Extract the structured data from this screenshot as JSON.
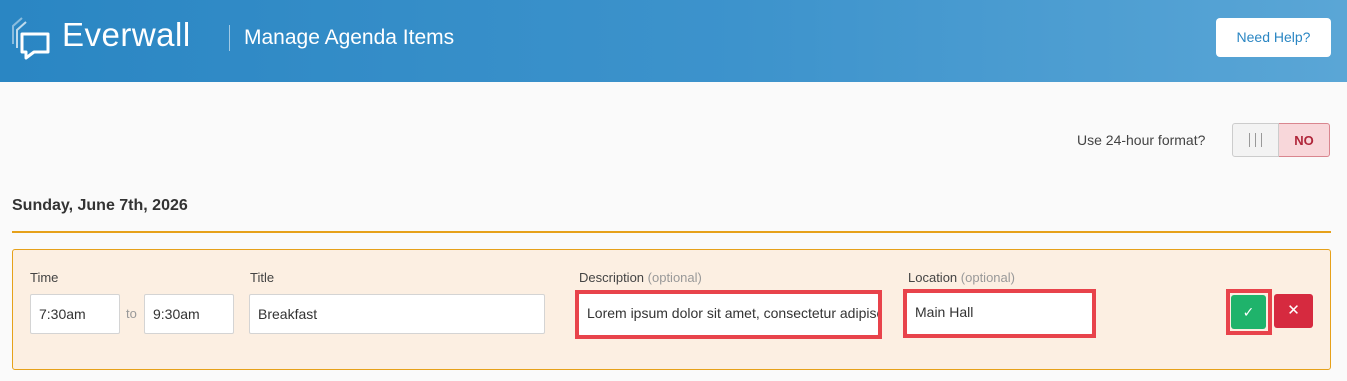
{
  "header": {
    "brand": "Everwall",
    "page_title": "Manage Agenda Items",
    "help_label": "Need Help?"
  },
  "time_format": {
    "label": "Use 24-hour format?",
    "state": "NO"
  },
  "day": {
    "heading": "Sunday, June 7th, 2026"
  },
  "agenda_item": {
    "time_label": "Time",
    "start_time": "7:30am",
    "to_label": "to",
    "end_time": "9:30am",
    "title_label": "Title",
    "title_value": "Breakfast",
    "description_label": "Description",
    "description_optional": "(optional)",
    "description_value": "Lorem ipsum dolor sit amet, consectetur adipiscing elit",
    "location_label": "Location",
    "location_optional": "(optional)",
    "location_value": "Main Hall",
    "save_icon": "check-icon",
    "cancel_icon": "x-icon"
  },
  "colors": {
    "header_start": "#2a86c3",
    "accent_rule": "#e6a11a",
    "highlight": "#e8434b",
    "save": "#1fb36b",
    "cancel": "#d62a3f"
  }
}
